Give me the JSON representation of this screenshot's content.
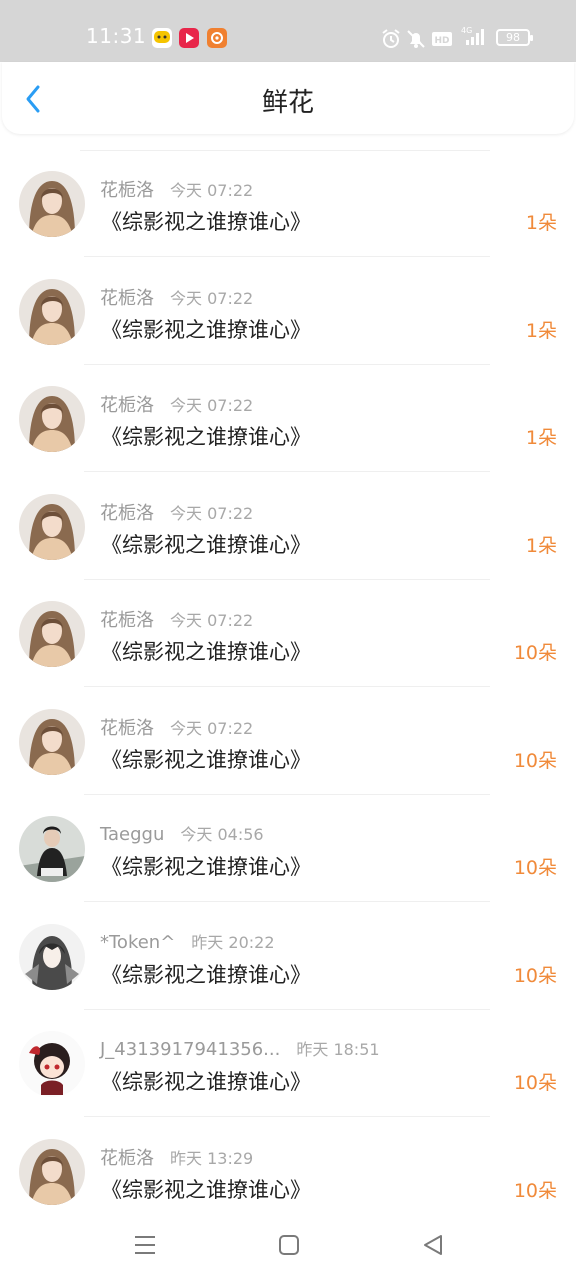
{
  "status_bar": {
    "time": "11:31",
    "battery": "98",
    "network": "4G",
    "hd": "HD",
    "icons": [
      "alarm-icon",
      "mute-icon",
      "hd-icon",
      "signal-icon",
      "battery-icon"
    ]
  },
  "header": {
    "title": "鲜花",
    "back_icon": "back-arrow-icon"
  },
  "colors": {
    "accent": "#f08a3a",
    "back": "#2a9df4",
    "status_bar_bg": "#d6d6d6"
  },
  "rows": [
    {
      "user": "花栀洛",
      "time": "今天 07:22",
      "book": "《综影视之谁撩谁心》",
      "count": "1朵",
      "avatar": "girl"
    },
    {
      "user": "花栀洛",
      "time": "今天 07:22",
      "book": "《综影视之谁撩谁心》",
      "count": "1朵",
      "avatar": "girl"
    },
    {
      "user": "花栀洛",
      "time": "今天 07:22",
      "book": "《综影视之谁撩谁心》",
      "count": "1朵",
      "avatar": "girl"
    },
    {
      "user": "花栀洛",
      "time": "今天 07:22",
      "book": "《综影视之谁撩谁心》",
      "count": "1朵",
      "avatar": "girl"
    },
    {
      "user": "花栀洛",
      "time": "今天 07:22",
      "book": "《综影视之谁撩谁心》",
      "count": "10朵",
      "avatar": "girl"
    },
    {
      "user": "花栀洛",
      "time": "今天 07:22",
      "book": "《综影视之谁撩谁心》",
      "count": "10朵",
      "avatar": "girl"
    },
    {
      "user": "Taeggu",
      "time": "今天 04:56",
      "book": "《综影视之谁撩谁心》",
      "count": "10朵",
      "avatar": "street"
    },
    {
      "user": "*Token^",
      "time": "昨天 20:22",
      "book": "《综影视之谁撩谁心》",
      "count": "10朵",
      "avatar": "anime"
    },
    {
      "user": "J_4313917941356...",
      "time": "昨天 18:51",
      "book": "《综影视之谁撩谁心》",
      "count": "10朵",
      "avatar": "chibi"
    },
    {
      "user": "花栀洛",
      "time": "昨天 13:29",
      "book": "《综影视之谁撩谁心》",
      "count": "10朵",
      "avatar": "girl"
    }
  ],
  "system_nav": {
    "menu_icon": "menu-icon",
    "home_icon": "home-square-icon",
    "back_icon": "back-triangle-icon"
  }
}
